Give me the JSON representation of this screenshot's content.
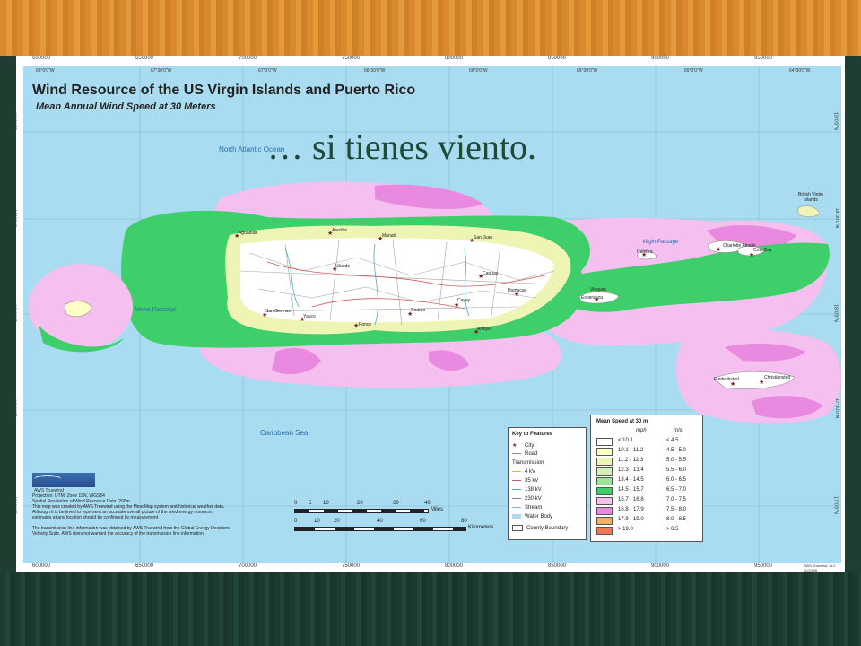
{
  "slide": {
    "overlay_text": "… si tienes viento."
  },
  "map": {
    "title": "Wind Resource of the US Virgin Islands and Puerto Rico",
    "subtitle": "Mean Annual Wind Speed at 30 Meters",
    "water_labels": {
      "ocean": "North Atlantic Ocean",
      "passage": "Mona Passage",
      "sea": "Caribbean Sea",
      "virgin_passage": "Virgin Passage"
    },
    "places": [
      {
        "name": "Aguadilla"
      },
      {
        "name": "Arecibo"
      },
      {
        "name": "Manati"
      },
      {
        "name": "San Juan"
      },
      {
        "name": "Utuado"
      },
      {
        "name": "Caguas"
      },
      {
        "name": "Humacao"
      },
      {
        "name": "Cayey"
      },
      {
        "name": "San German"
      },
      {
        "name": "Yauco"
      },
      {
        "name": "Ponce"
      },
      {
        "name": "Coamo"
      },
      {
        "name": "Arroyo"
      },
      {
        "name": "Culebra"
      },
      {
        "name": "Vieques"
      },
      {
        "name": "Esperanza"
      },
      {
        "name": "Charlotte Amalie"
      },
      {
        "name": "Cruz Bay"
      },
      {
        "name": "Frederiksted"
      },
      {
        "name": "Christiansted"
      },
      {
        "name": "British Virgin Islands"
      }
    ],
    "top_coords": {
      "easting": [
        "600000",
        "650000",
        "700000",
        "750000",
        "800000",
        "850000",
        "900000",
        "950000"
      ],
      "lon": [
        "68°0'0\"W",
        "67°30'0\"W",
        "67°0'0\"W",
        "66°30'0\"W",
        "66°0'0\"W",
        "65°30'0\"W",
        "65°0'0\"W",
        "64°30'0\"W"
      ]
    },
    "side_coords": {
      "northing": [
        "2100000",
        "2050000",
        "2000000",
        "1950000",
        "1900000"
      ],
      "lat": [
        "19°0'0\"N",
        "18°30'0\"N",
        "18°0'0\"N",
        "17°30'0\"N",
        "17°0'0\"N"
      ]
    },
    "brand": "AWS Truewind",
    "credits": [
      "Projection: UTM, Zone 19N, WGS84",
      "Spatial Resolution of Wind Resource Data: 200m",
      "This map was created by AWS Truewind using the MesoMap system and historical weather data.",
      "Although it is believed to represent an accurate overall picture of the wind energy resource,",
      "estimates at any location should be confirmed by measurement.",
      "",
      "The transmission line information was obtained by AWS Truewind from the Global Energy Decisions",
      "Velocity Suite. AWS does not warrant the accuracy of the transmission line information."
    ],
    "scale": {
      "miles_ticks": [
        "0",
        "5",
        "10",
        "20",
        "30",
        "40"
      ],
      "miles_unit": "Miles",
      "km_ticks": [
        "0",
        "10",
        "20",
        "40",
        "60",
        "80"
      ],
      "km_unit": "Kilometers"
    },
    "key": {
      "title": "Key to Features",
      "items": [
        {
          "label": "City",
          "kind": "star"
        },
        {
          "label": "Road",
          "kind": "road"
        },
        {
          "label": "Transmission",
          "kind": "heading"
        },
        {
          "label": "4 kV",
          "kind": "line",
          "color": "#e8b04a"
        },
        {
          "label": "35 kV",
          "kind": "line",
          "color": "#d05a5a"
        },
        {
          "label": "138 kV",
          "kind": "line",
          "color": "#4aa8c8"
        },
        {
          "label": "230 kV",
          "kind": "line",
          "color": "#7a7aa8"
        },
        {
          "label": "Stream",
          "kind": "line",
          "color": "#7fb6e0"
        },
        {
          "label": "Water Body",
          "kind": "water"
        },
        {
          "label": "County Boundary",
          "kind": "box"
        }
      ]
    },
    "legend": {
      "title": "Mean Speed at 30 m",
      "col1": "mph",
      "col2": "m/s",
      "rows": [
        {
          "mph": "< 10.1",
          "ms": "< 4.5",
          "color": "#ffffff"
        },
        {
          "mph": "10.1 - 11.2",
          "ms": "4.5 - 5.0",
          "color": "#ffffc8"
        },
        {
          "mph": "11.2 - 12.3",
          "ms": "5.0 - 5.5",
          "color": "#eef5b4"
        },
        {
          "mph": "12.3 - 13.4",
          "ms": "5.5 - 6.0",
          "color": "#d4f0b8"
        },
        {
          "mph": "13.4 - 14.5",
          "ms": "6.0 - 6.5",
          "color": "#9ee39a"
        },
        {
          "mph": "14.5 - 15.7",
          "ms": "6.5 - 7.0",
          "color": "#3fcf6a"
        },
        {
          "mph": "15.7 - 16.8",
          "ms": "7.0 - 7.5",
          "color": "#f5bff0"
        },
        {
          "mph": "16.8 - 17.9",
          "ms": "7.5 - 8.0",
          "color": "#e98ae0"
        },
        {
          "mph": "17.9 - 19.0",
          "ms": "8.0 - 8.5",
          "color": "#f2b060"
        },
        {
          "mph": "> 19.0",
          "ms": "> 8.5",
          "color": "#ef7a5a"
        }
      ]
    },
    "footer_credit": "AWS Truewind, LLC 11/29/06",
    "colors": {
      "water": "#a9dcf0",
      "land": "#ffffff",
      "green": "#3fcf6a",
      "pink": "#f5bff0",
      "magenta": "#e98ae0",
      "light": "#d4f0b8",
      "title": "#1f3d31"
    }
  }
}
